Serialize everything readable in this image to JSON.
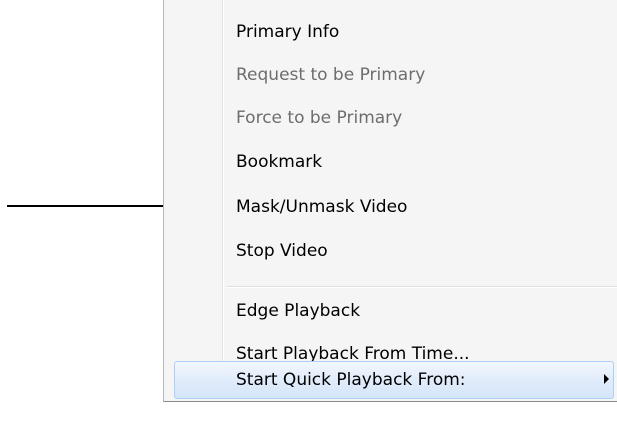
{
  "menu": {
    "items": [
      {
        "label": "Primary Info"
      },
      {
        "label": "Request to be Primary"
      },
      {
        "label": "Force to be Primary"
      },
      {
        "label": "Bookmark"
      },
      {
        "label": "Mask/Unmask Video"
      },
      {
        "label": "Stop Video"
      },
      {
        "label": "Edge Playback"
      },
      {
        "label": "Start Playback From Time..."
      },
      {
        "label": "Start Quick Playback From:"
      }
    ]
  },
  "icons": {
    "annotation_arrow": "arrow-right-icon",
    "submenu": "chevron-right-icon"
  },
  "colors": {
    "menu_background": "#f5f5f5",
    "disabled_text": "#6d6d6d",
    "highlight_border": "#aecff7"
  }
}
